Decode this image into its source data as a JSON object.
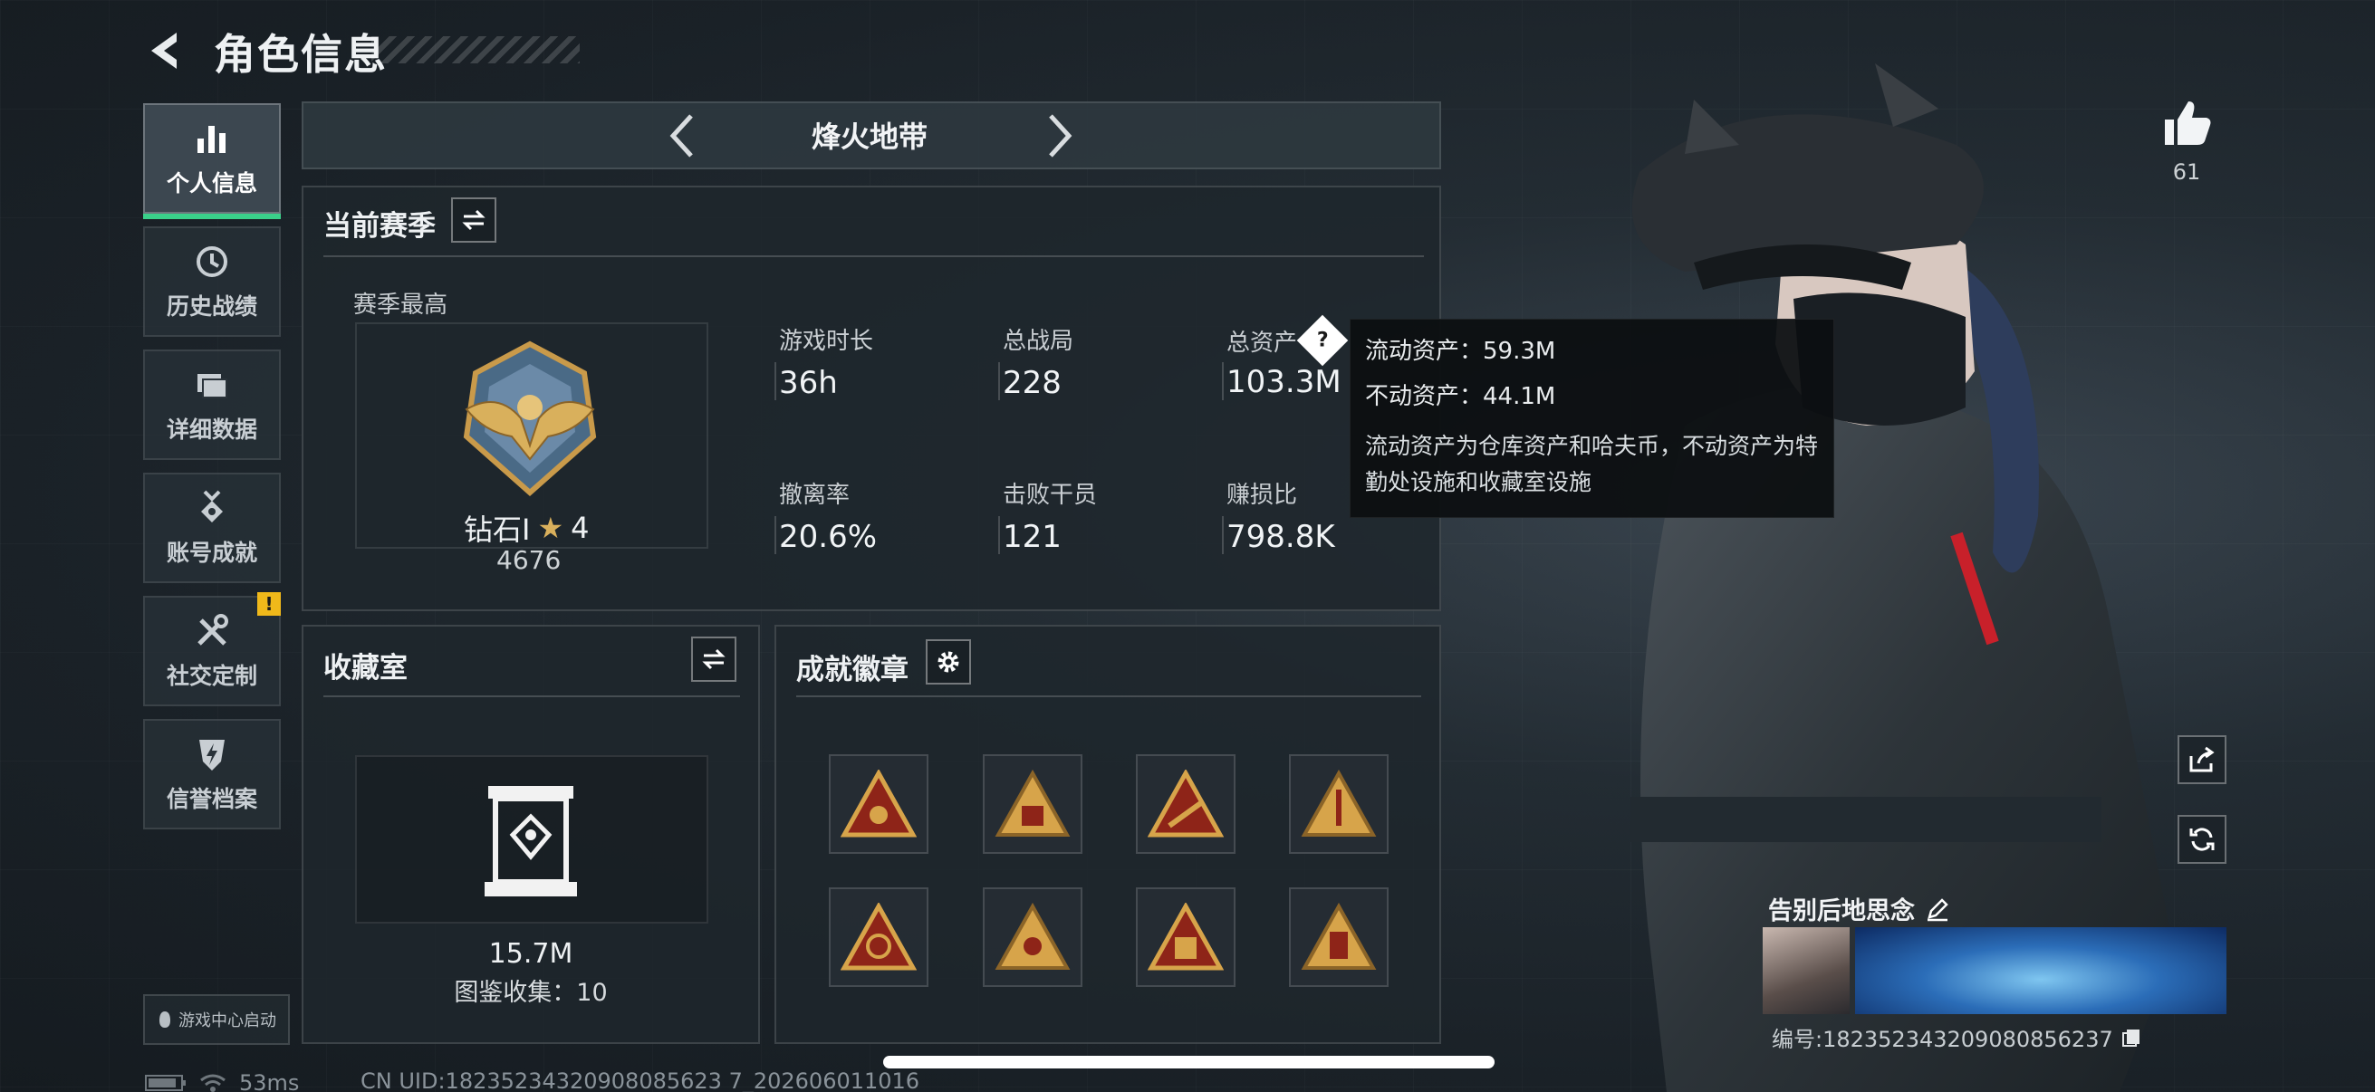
{
  "header": {
    "title": "角色信息"
  },
  "sidebar": {
    "items": [
      {
        "label": "个人信息",
        "icon": "bar-chart-icon"
      },
      {
        "label": "历史战绩",
        "icon": "history-icon"
      },
      {
        "label": "详细数据",
        "icon": "folder-icon"
      },
      {
        "label": "账号成就",
        "icon": "medal-icon"
      },
      {
        "label": "社交定制",
        "icon": "wrench-icon"
      },
      {
        "label": "信誉档案",
        "icon": "shield-icon"
      }
    ],
    "warning_badge": "!",
    "game_center": "游戏中心启动"
  },
  "mode_tab": {
    "title": "烽火地带"
  },
  "season": {
    "title": "当前赛季",
    "best_label": "赛季最高",
    "rank_name": "钻石Ⅰ",
    "rank_stars": "4",
    "rank_points": "4676",
    "stats": [
      {
        "label": "游戏时长",
        "value": "36h"
      },
      {
        "label": "总战局",
        "value": "228"
      },
      {
        "label": "总资产",
        "value": "103.3M"
      },
      {
        "label": "撤离率",
        "value": "20.6%"
      },
      {
        "label": "击败干员",
        "value": "121"
      },
      {
        "label": "赚损比",
        "value": "798.8K"
      }
    ]
  },
  "tooltip": {
    "liquid": "流动资产：59.3M",
    "fixed": "不动资产：44.1M",
    "desc": "流动资产为仓库资产和哈夫币，不动资产为特勤处设施和收藏室设施"
  },
  "collection": {
    "title": "收藏室",
    "value": "15.7M",
    "count": "图鉴收集：10"
  },
  "achievements": {
    "title": "成就徽章",
    "badges": [
      "badge-1",
      "badge-2",
      "badge-3",
      "badge-4",
      "badge-5",
      "badge-6",
      "badge-7",
      "badge-8"
    ]
  },
  "profile": {
    "likes": "61",
    "nickname": "告别后地思念",
    "uid_line": "编号:18235234320908085623​7"
  },
  "footer": {
    "ping": "53ms",
    "uid": "CN UID:18235234320908085623 7_202606011016"
  },
  "colors": {
    "accent_green": "#3ad08a",
    "warning_yellow": "#f0b91a",
    "badge_red": "#8e2418",
    "badge_gold": "#d7a44a"
  }
}
